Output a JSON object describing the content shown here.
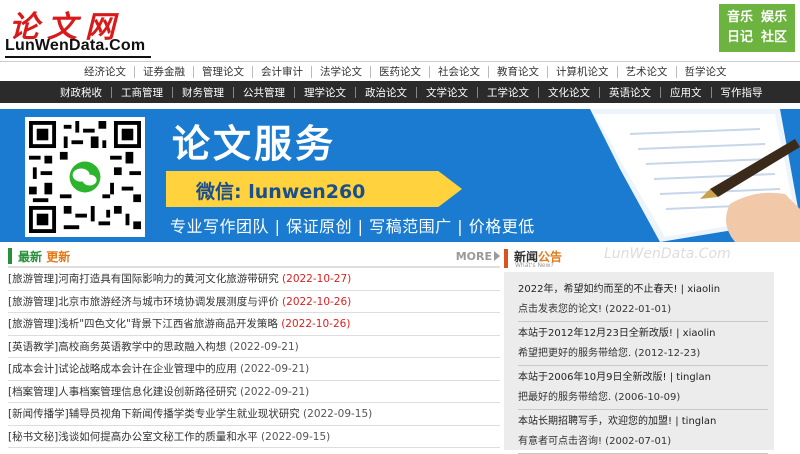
{
  "logo": {
    "cn": "论文网",
    "en": "LunWenData.Com"
  },
  "fun_menu": [
    "音乐",
    "娱乐",
    "日记",
    "社区"
  ],
  "nav_top": [
    "经济论文",
    "证券金融",
    "管理论文",
    "会计审计",
    "法学论文",
    "医药论文",
    "社会论文",
    "教育论文",
    "计算机论文",
    "艺术论文",
    "哲学论文"
  ],
  "nav_main": [
    "财政税收",
    "工商管理",
    "财务管理",
    "公共管理",
    "理学论文",
    "政治论文",
    "文学论文",
    "工学论文",
    "文化论文",
    "英语论文",
    "应用文",
    "写作指导"
  ],
  "banner": {
    "title": "论文服务",
    "wechat": "微信: lunwen260",
    "slogan": "专业写作团队 | 保证原创 | 写稿范围广 | 价格更低"
  },
  "latest": {
    "title_a": "最新",
    "title_b": "更新",
    "more": "MORE",
    "items": [
      {
        "text": "[旅游管理]河南打造具有国际影响力的黄河文化旅游带研究",
        "date": "(2022-10-27)",
        "highlight": true
      },
      {
        "text": "[旅游管理]北京市旅游经济与城市环境协调发展测度与评价",
        "date": "(2022-10-26)",
        "highlight": true
      },
      {
        "text": "[旅游管理]浅析\"四色文化\"背景下江西省旅游商品开发策略",
        "date": "(2022-10-26)",
        "highlight": true
      },
      {
        "text": "[英语教学]高校商务英语教学中的思政融入构想",
        "date": "(2022-09-21)",
        "highlight": false
      },
      {
        "text": "[成本会计]试论战略成本会计在企业管理中的应用",
        "date": "(2022-09-21)",
        "highlight": false
      },
      {
        "text": "[档案管理]人事档案管理信息化建设创新路径研究",
        "date": "(2022-09-21)",
        "highlight": false
      },
      {
        "text": "[新闻传播学]辅导员视角下新闻传播学类专业学生就业现状研究",
        "date": "(2022-09-15)",
        "highlight": false
      },
      {
        "text": "[秘书文秘]浅谈如何提高办公室文秘工作的质量和水平",
        "date": "(2022-09-15)",
        "highlight": false
      }
    ]
  },
  "news": {
    "title_a": "新闻",
    "title_b": "公告",
    "subtitle": "What's New?",
    "watermark": "LunWenData.Com",
    "items": [
      {
        "line1": "2022年，希望如约而至的不止春天!",
        "author": "| xiaolin",
        "line2": "点击发表您的论文! (2022-01-01)"
      },
      {
        "line1": "本站于2012年12月23日全新改版!",
        "author": "| xiaolin",
        "line2": "希望把更好的服务带给您. (2012-12-23)"
      },
      {
        "line1": "本站于2006年10月9日全新改版!",
        "author": "| tinglan",
        "line2": "把最好的服务带给您. (2006-10-09)"
      },
      {
        "line1": "本站长期招聘写手，欢迎您的加盟!",
        "author": "| tinglan",
        "line2": "有意者可点击咨询! (2002-07-01)"
      }
    ]
  },
  "colors": {
    "red": "#e01e1e",
    "green": "#6cb33f",
    "banner_blue": "#1a7bd0",
    "yellow": "#ffd23e",
    "orange": "#e07a1a"
  }
}
